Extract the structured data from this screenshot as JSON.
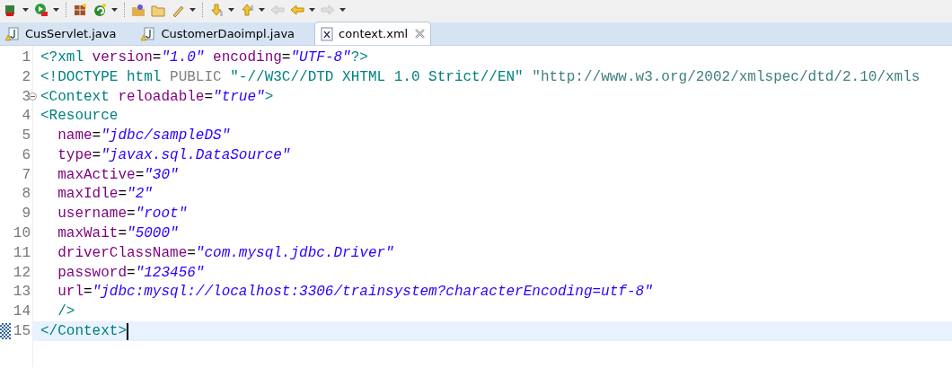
{
  "toolbar": {
    "items": [
      {
        "dropdown": true,
        "disabled": false
      },
      {
        "dropdown": true,
        "disabled": false
      },
      {
        "dropdown": false,
        "disabled": false
      },
      {
        "dropdown": true,
        "disabled": false
      },
      {
        "dropdown": false,
        "disabled": false
      },
      {
        "dropdown": false,
        "disabled": false
      },
      {
        "dropdown": true,
        "disabled": false
      },
      {
        "dropdown": true,
        "disabled": false
      },
      {
        "dropdown": true,
        "disabled": false
      },
      {
        "dropdown": false,
        "disabled": true
      },
      {
        "dropdown": true,
        "disabled": false
      },
      {
        "dropdown": true,
        "disabled": true
      }
    ]
  },
  "tabs": [
    {
      "label": "CusServlet.java",
      "kind": "java",
      "selected": false
    },
    {
      "label": "CustomerDaoimpl.java",
      "kind": "java",
      "selected": false
    },
    {
      "label": "context.xml",
      "kind": "xml",
      "selected": true
    }
  ],
  "editor": {
    "lines": [
      {
        "number": "1",
        "segments": [
          {
            "kind": "tag",
            "text": "<?xml "
          },
          {
            "kind": "attr",
            "text": "version"
          },
          {
            "kind": "eq",
            "text": "="
          },
          {
            "kind": "value",
            "text": "\"1.0\" "
          },
          {
            "kind": "attr",
            "text": "encoding"
          },
          {
            "kind": "eq",
            "text": "="
          },
          {
            "kind": "value",
            "text": "\"UTF-8\""
          },
          {
            "kind": "tag",
            "text": "?>"
          }
        ]
      },
      {
        "number": "2",
        "segments": [
          {
            "kind": "tag",
            "text": "<!DOCTYPE html "
          },
          {
            "kind": "keyword",
            "text": "PUBLIC "
          },
          {
            "kind": "tag",
            "text": "\"-//W3C//DTD XHTML 1.0 Strict//EN\" "
          },
          {
            "kind": "doc",
            "text": "\"http://www.w3.org/2002/xmlspec/dtd/2.10/xmls"
          }
        ]
      },
      {
        "number": "3",
        "folded": false,
        "segments": [
          {
            "kind": "tag",
            "text": "<Context "
          },
          {
            "kind": "attr",
            "text": "reloadable"
          },
          {
            "kind": "eq",
            "text": "="
          },
          {
            "kind": "value",
            "text": "\"true\""
          },
          {
            "kind": "tag",
            "text": ">"
          }
        ]
      },
      {
        "number": "4",
        "segments": [
          {
            "kind": "tag",
            "text": "<Resource"
          }
        ]
      },
      {
        "number": "5",
        "segments": [
          {
            "kind": "attr",
            "text": "  name"
          },
          {
            "kind": "eq",
            "text": "="
          },
          {
            "kind": "value",
            "text": "\"jdbc/sampleDS\""
          }
        ]
      },
      {
        "number": "6",
        "segments": [
          {
            "kind": "attr",
            "text": "  type"
          },
          {
            "kind": "eq",
            "text": "="
          },
          {
            "kind": "value",
            "text": "\"javax.sql.DataSource\""
          }
        ]
      },
      {
        "number": "7",
        "segments": [
          {
            "kind": "attr",
            "text": "  maxActive"
          },
          {
            "kind": "eq",
            "text": "="
          },
          {
            "kind": "value",
            "text": "\"30\""
          }
        ]
      },
      {
        "number": "8",
        "segments": [
          {
            "kind": "attr",
            "text": "  maxIdle"
          },
          {
            "kind": "eq",
            "text": "="
          },
          {
            "kind": "value",
            "text": "\"2\""
          }
        ]
      },
      {
        "number": "9",
        "segments": [
          {
            "kind": "attr",
            "text": "  username"
          },
          {
            "kind": "eq",
            "text": "="
          },
          {
            "kind": "value",
            "text": "\"root\""
          }
        ]
      },
      {
        "number": "10",
        "segments": [
          {
            "kind": "attr",
            "text": "  maxWait"
          },
          {
            "kind": "eq",
            "text": "="
          },
          {
            "kind": "value",
            "text": "\"5000\""
          }
        ]
      },
      {
        "number": "11",
        "segments": [
          {
            "kind": "attr",
            "text": "  driverClassName"
          },
          {
            "kind": "eq",
            "text": "="
          },
          {
            "kind": "value",
            "text": "\"com.mysql.jdbc.Driver\""
          }
        ]
      },
      {
        "number": "12",
        "segments": [
          {
            "kind": "attr",
            "text": "  password"
          },
          {
            "kind": "eq",
            "text": "="
          },
          {
            "kind": "value",
            "text": "\"123456\""
          }
        ]
      },
      {
        "number": "13",
        "segments": [
          {
            "kind": "attr",
            "text": "  url"
          },
          {
            "kind": "eq",
            "text": "="
          },
          {
            "kind": "value",
            "text": "\"jdbc:mysql://localhost:3306/trainsystem?characterEncoding=utf-8\""
          }
        ]
      },
      {
        "number": "14",
        "segments": [
          {
            "kind": "tag",
            "text": "  />"
          }
        ]
      },
      {
        "number": "15",
        "current": true,
        "segments": [
          {
            "kind": "tag",
            "text": "</Context>"
          }
        ]
      }
    ]
  }
}
